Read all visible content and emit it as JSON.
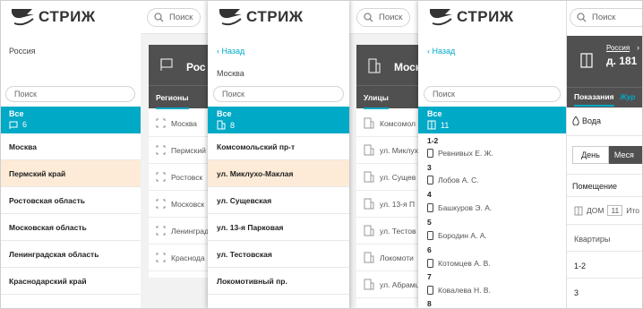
{
  "brand": "СТРИЖ",
  "search_placeholder": "Поиск",
  "back_label": "Назад",
  "all_label": "Все",
  "panel1": {
    "country": "Россия",
    "count": "6",
    "regions": [
      "Москва",
      "Пермский край",
      "Ростовская область",
      "Московская область",
      "Ленинградская область",
      "Краснодарский край"
    ]
  },
  "bg1": {
    "title": "Рос",
    "tab": "Регионы",
    "rows": [
      "Москва",
      "Пермский",
      "Ростовск",
      "Московск",
      "Ленинград",
      "Краснода"
    ]
  },
  "panel2": {
    "city": "Москва",
    "count": "8",
    "streets": [
      "Комсомольский пр-т",
      "ул. Миклухо-Маклая",
      "ул. Сущевская",
      "ул. 13-я Парковая",
      "ул. Тестовская",
      "Локомотивный пр."
    ]
  },
  "bg2": {
    "title": "Моск",
    "tab": "Улицы",
    "rows": [
      "Комсомол",
      "ул. Миклух",
      "ул. Сущев",
      "ул. 13-я П",
      "ул. Тестов",
      "Локомоти",
      "ул. Абрамц"
    ]
  },
  "panel3": {
    "count": "11",
    "groups": [
      {
        "label": "1-2",
        "owner": "Ревнивых Е. Ж."
      },
      {
        "label": "3",
        "owner": "Лобов А. С."
      },
      {
        "label": "4",
        "owner": "Башкуров Э. А."
      },
      {
        "label": "5",
        "owner": "Бородин А. А."
      },
      {
        "label": "6",
        "owner": "Котомцев А. В."
      },
      {
        "label": "7",
        "owner": "Ковалева Н. В."
      },
      {
        "label": "8",
        "owner": ""
      }
    ]
  },
  "panel4": {
    "crumb": "Россия",
    "title": "д. 181",
    "tab_active": "Показания",
    "tab_next": "Жур",
    "resource": "Вода",
    "period_day": "День",
    "period_month": "Меся",
    "room_label": "Помещение",
    "house_label": "ДОМ",
    "house_count": "11",
    "total_label": "Ито",
    "flats_label": "Квартиры",
    "flats": [
      "1-2",
      "3"
    ]
  },
  "colors": {
    "accent": "#00a9c6",
    "header_dark": "#505050",
    "highlight": "#fdebd7"
  }
}
